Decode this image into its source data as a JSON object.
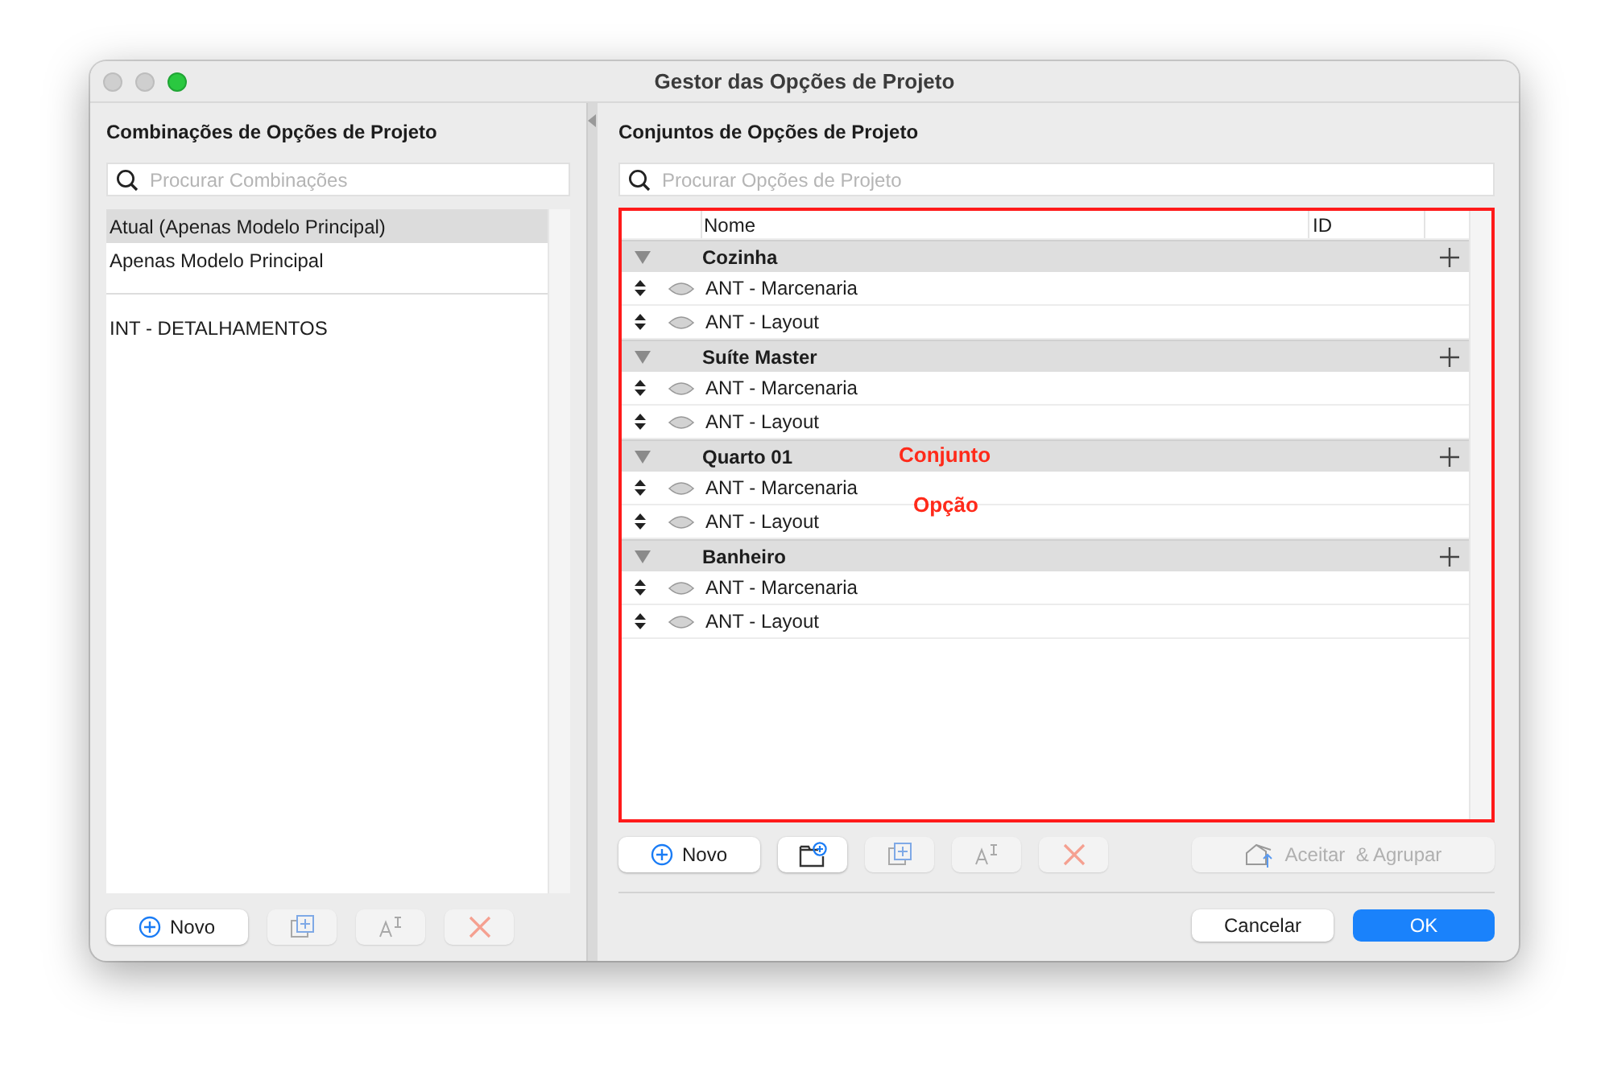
{
  "window": {
    "title": "Gestor das Opções de Projeto"
  },
  "left_panel": {
    "title": "Combinações de Opções de Projeto",
    "search": {
      "placeholder": "Procurar Combinações"
    },
    "items": [
      {
        "kind": "item",
        "label": "Atual (Apenas Modelo Principal)",
        "selected": true
      },
      {
        "kind": "item",
        "label": "Apenas Modelo Principal",
        "selected": false
      },
      {
        "kind": "separator"
      },
      {
        "kind": "item",
        "label": "INT - DETALHAMENTOS",
        "selected": false
      }
    ],
    "buttons": [
      {
        "kind": "new",
        "label": "Novo",
        "disabled": false
      },
      {
        "kind": "duplicate",
        "disabled": true
      },
      {
        "kind": "rename",
        "disabled": true
      },
      {
        "kind": "delete",
        "disabled": true
      }
    ]
  },
  "right_panel": {
    "title": "Conjuntos de Opções de Projeto",
    "search": {
      "placeholder": "Procurar Opções de Projeto"
    },
    "columns": [
      "Nome",
      "ID"
    ],
    "sets": [
      {
        "name": "Cozinha",
        "expanded": true,
        "options": [
          {
            "name": "ANT - Marcenaria"
          },
          {
            "name": "ANT - Layout"
          }
        ]
      },
      {
        "name": "Suíte Master",
        "expanded": true,
        "options": [
          {
            "name": "ANT - Marcenaria"
          },
          {
            "name": "ANT - Layout"
          }
        ]
      },
      {
        "name": "Quarto 01",
        "expanded": true,
        "options": [
          {
            "name": "ANT - Marcenaria"
          },
          {
            "name": "ANT - Layout"
          }
        ]
      },
      {
        "name": "Banheiro",
        "expanded": true,
        "options": [
          {
            "name": "ANT - Marcenaria"
          },
          {
            "name": "ANT - Layout"
          }
        ]
      }
    ],
    "buttons": [
      {
        "kind": "new",
        "label": "Novo",
        "disabled": false
      },
      {
        "kind": "new-set",
        "disabled": false
      },
      {
        "kind": "duplicate",
        "disabled": true
      },
      {
        "kind": "rename",
        "disabled": true
      },
      {
        "kind": "delete",
        "disabled": true
      }
    ],
    "accept_button": {
      "label": "Aceitar  & Agrupar",
      "disabled": true
    },
    "dialog_buttons": [
      {
        "label": "Cancelar",
        "kind": "cancel"
      },
      {
        "label": "OK",
        "kind": "default"
      }
    ]
  },
  "annotations": [
    {
      "text": "Conjunto"
    },
    {
      "text": "Opção"
    }
  ]
}
